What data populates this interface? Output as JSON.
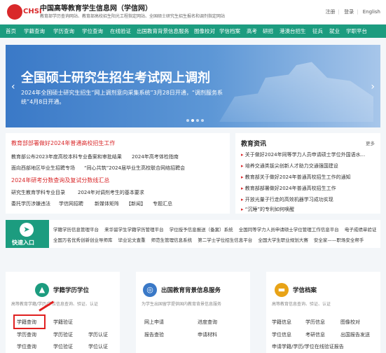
{
  "header": {
    "logo_text": "CHSI",
    "site_title": "中国高等教育学生信息网（学信网）",
    "site_subtitle": "教育部学历查询网站、教育部高校招生阳光工程指定网站、全国硕士研究生招生报名和调剂指定网站",
    "links": [
      "注册",
      "登录",
      "English"
    ]
  },
  "nav": {
    "items": [
      "首页",
      "学籍查询",
      "学历查询",
      "学位查询",
      "在线验证",
      "出国教育背景信息服务",
      "图像校对",
      "学信档案",
      "高考",
      "研招",
      "港澳台招生",
      "征兵",
      "就业",
      "学职平台"
    ]
  },
  "banner": {
    "title": "全国硕士研究生招生考试网上调剂",
    "text": "2024年全国硕士研究生招生“网上调剂意向采集系统”3月28日开通，“调剂服务系统”4月8日开通。",
    "prev": "‹",
    "next": "›"
  },
  "news": {
    "headline1": "教育部部署做好2024年普通高校招生工作",
    "row1a": "教育部公布2023年度高校本科专业备案和审批结果",
    "row1b": "2024年高考体检指南",
    "row2": "面向西部地区毕业生招聘专场",
    "row2b": "“同心共筑”2024届毕业生高校联合网络招聘会",
    "headline2": "2024年研考分数查询及复试分数线汇总",
    "row3a": "研究生教育学科专业目录",
    "row3b": "2024年对调剂考生的基本要求",
    "row4": [
      "委托学历涉嫌违法",
      "学信网招聘",
      "新媒体矩阵",
      "【新闻】",
      "专题汇总"
    ]
  },
  "edu_news": {
    "title": "教育资讯",
    "more": "更多",
    "items": [
      "关于做好2024年同等学力人员申请硕士学位外国语水...",
      "培养交通类拔尖创新人才助力交通强国建设",
      "教育部关于做好2024年普通高校招生工作的通知",
      "教育部部署做好2024年普通高校招生工作",
      "开放光量子行走的高效机器学习成功实现",
      "“沉睡”的专利如何唤醒"
    ]
  },
  "quick": {
    "label": "快速入口",
    "row1": [
      "学籍学历信息管理平台",
      "来华留学生学籍学历管理平台",
      "学位授予信息报送（备案）系统",
      "全国同等学力人员申请硕士学位管理工作信息平台",
      "电子成绩单验证"
    ],
    "row2": [
      "全国万名优秀创新创业导师库",
      "毕业论文查重",
      "师范生管理信息系统",
      "第二学士学位招生信息平台",
      "全国大学生职业规划大赛",
      "安全家——职场安全帮手"
    ]
  },
  "cards": [
    {
      "title": "学籍学历学位",
      "desc": "高等教育学籍/学历/学位信息查询、验证、认证",
      "links": [
        "学籍查询",
        "学籍验证",
        "学历查询",
        "学历验证",
        "学历认证",
        "学位查询",
        "学位验证",
        "学位认证"
      ]
    },
    {
      "title": "出国教育背景信息服务",
      "desc": "为学生出国留学提供国内教育背景信息服务",
      "links": [
        "网上申请",
        "进度查询",
        "报告查验",
        "申请材料"
      ]
    },
    {
      "title": "学信档案",
      "desc": "高等教育信息查询、验证、认证",
      "links": [
        "学籍信息",
        "学历信息",
        "图像校对",
        "学位信息",
        "考研信息",
        "出国报告发送",
        "申请学籍/学历/学位在线验证报告"
      ]
    }
  ],
  "colors": {
    "brand_green": "#1c9c7f",
    "brand_red": "#d9282a",
    "highlight": "#e02020"
  }
}
